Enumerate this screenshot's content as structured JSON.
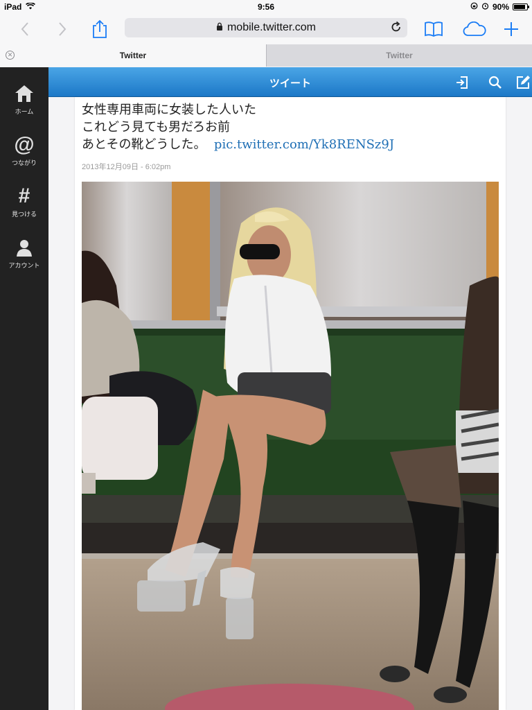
{
  "status": {
    "device": "iPad",
    "time": "9:56",
    "battery": "90%",
    "battery_level": 0.9
  },
  "browser": {
    "url": "mobile.twitter.com",
    "tabs": [
      {
        "label": "Twitter",
        "active": true
      },
      {
        "label": "Twitter",
        "active": false
      }
    ]
  },
  "sidebar": {
    "items": [
      {
        "label": "ホーム",
        "icon": "home-icon"
      },
      {
        "label": "つながり",
        "icon": "at-icon",
        "glyph": "@"
      },
      {
        "label": "見つける",
        "icon": "hashtag-icon",
        "glyph": "#"
      },
      {
        "label": "アカウント",
        "icon": "account-icon"
      }
    ]
  },
  "header": {
    "title": "ツイート"
  },
  "tweet": {
    "line1": "女性専用車両に女装した人いた",
    "line2": "これどう見ても男だろお前",
    "line3": "あとその靴どうした。",
    "link": "pic.twitter.com/Yk8RENSz9J",
    "timestamp": "2013年12月09日 - 6:02pm"
  },
  "colors": {
    "header_blue": "#2b8ad6",
    "sidebar_bg": "#222222",
    "link": "#1f6fb5"
  }
}
